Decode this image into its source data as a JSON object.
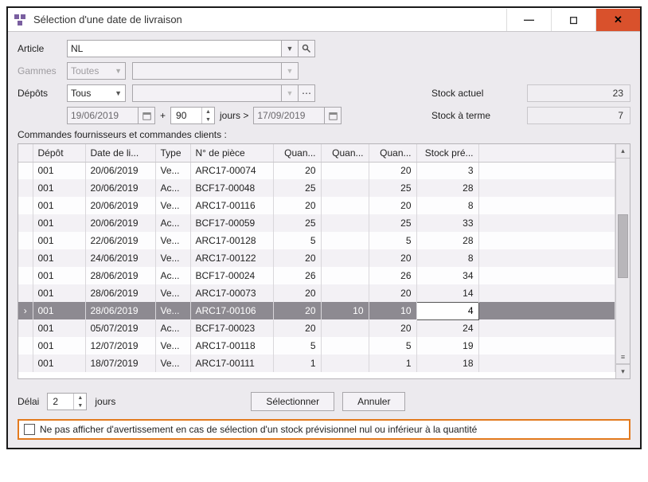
{
  "window": {
    "title": "Sélection d'une date de livraison"
  },
  "form": {
    "article_label": "Article",
    "article_value": "NL",
    "gammes_label": "Gammes",
    "gammes_value": "Toutes",
    "depots_label": "Dépôts",
    "depots_value": "Tous",
    "date_start": "19/06/2019",
    "days_value": "90",
    "days_unit": "jours >",
    "date_end": "17/09/2019",
    "plus": "+",
    "stock_actuel_label": "Stock actuel",
    "stock_actuel_value": "23",
    "stock_terme_label": "Stock à terme",
    "stock_terme_value": "7"
  },
  "grid": {
    "title": "Commandes fournisseurs et commandes clients :",
    "headers": [
      "Dépôt",
      "Date de li...",
      "Type",
      "N° de pièce",
      "Quan...",
      "Quan...",
      "Quan...",
      "Stock pré..."
    ],
    "rows": [
      {
        "depot": "001",
        "date": "20/06/2019",
        "type": "Ve...",
        "piece": "ARC17-00074",
        "q1": "20",
        "q2": "",
        "q3": "20",
        "stock": "3",
        "selected": false
      },
      {
        "depot": "001",
        "date": "20/06/2019",
        "type": "Ac...",
        "piece": "BCF17-00048",
        "q1": "25",
        "q2": "",
        "q3": "25",
        "stock": "28",
        "selected": false
      },
      {
        "depot": "001",
        "date": "20/06/2019",
        "type": "Ve...",
        "piece": "ARC17-00116",
        "q1": "20",
        "q2": "",
        "q3": "20",
        "stock": "8",
        "selected": false
      },
      {
        "depot": "001",
        "date": "20/06/2019",
        "type": "Ac...",
        "piece": "BCF17-00059",
        "q1": "25",
        "q2": "",
        "q3": "25",
        "stock": "33",
        "selected": false
      },
      {
        "depot": "001",
        "date": "22/06/2019",
        "type": "Ve...",
        "piece": "ARC17-00128",
        "q1": "5",
        "q2": "",
        "q3": "5",
        "stock": "28",
        "selected": false
      },
      {
        "depot": "001",
        "date": "24/06/2019",
        "type": "Ve...",
        "piece": "ARC17-00122",
        "q1": "20",
        "q2": "",
        "q3": "20",
        "stock": "8",
        "selected": false
      },
      {
        "depot": "001",
        "date": "28/06/2019",
        "type": "Ac...",
        "piece": "BCF17-00024",
        "q1": "26",
        "q2": "",
        "q3": "26",
        "stock": "34",
        "selected": false
      },
      {
        "depot": "001",
        "date": "28/06/2019",
        "type": "Ve...",
        "piece": "ARC17-00073",
        "q1": "20",
        "q2": "",
        "q3": "20",
        "stock": "14",
        "selected": false
      },
      {
        "depot": "001",
        "date": "28/06/2019",
        "type": "Ve...",
        "piece": "ARC17-00106",
        "q1": "20",
        "q2": "10",
        "q3": "10",
        "stock": "4",
        "selected": true
      },
      {
        "depot": "001",
        "date": "05/07/2019",
        "type": "Ac...",
        "piece": "BCF17-00023",
        "q1": "20",
        "q2": "",
        "q3": "20",
        "stock": "24",
        "selected": false
      },
      {
        "depot": "001",
        "date": "12/07/2019",
        "type": "Ve...",
        "piece": "ARC17-00118",
        "q1": "5",
        "q2": "",
        "q3": "5",
        "stock": "19",
        "selected": false
      },
      {
        "depot": "001",
        "date": "18/07/2019",
        "type": "Ve...",
        "piece": "ARC17-00111",
        "q1": "1",
        "q2": "",
        "q3": "1",
        "stock": "18",
        "selected": false
      }
    ]
  },
  "footer": {
    "delai_label": "Délai",
    "delai_value": "2",
    "delai_unit": "jours",
    "select_btn": "Sélectionner",
    "cancel_btn": "Annuler",
    "warning_text": "Ne pas afficher d'avertissement en cas de sélection d'un stock prévisionnel nul ou inférieur à la quantité"
  }
}
